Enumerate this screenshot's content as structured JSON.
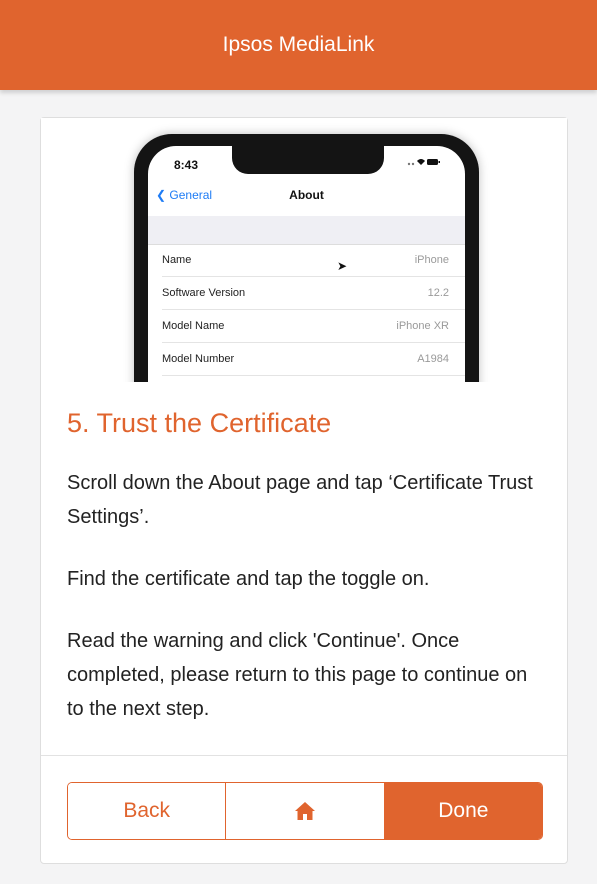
{
  "header": {
    "title": "Ipsos MediaLink"
  },
  "phone": {
    "time": "8:43",
    "status_icons": "..▴▬",
    "back_label": "General",
    "nav_title": "About",
    "rows": [
      {
        "key": "Name",
        "value": "iPhone"
      },
      {
        "key": "Software Version",
        "value": "12.2"
      },
      {
        "key": "Model Name",
        "value": "iPhone XR"
      },
      {
        "key": "Model Number",
        "value": "A1984"
      }
    ]
  },
  "step": {
    "title": "5. Trust the Certificate",
    "paragraphs": [
      "Scroll down the About page and tap ‘Certificate Trust Settings’.",
      "Find the certificate and tap the toggle on.",
      "Read the warning and click 'Continue'. Once completed, please return to this page to continue on to the next step."
    ]
  },
  "buttons": {
    "back": "Back",
    "home_icon": "home-icon",
    "done": "Done"
  },
  "colors": {
    "accent": "#e0642e",
    "link": "#1e7cf5"
  }
}
